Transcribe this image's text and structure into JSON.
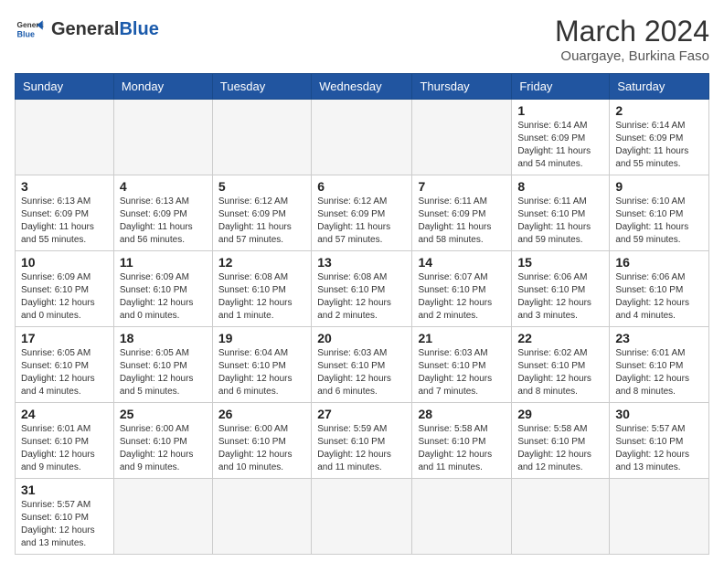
{
  "logo": {
    "text_general": "General",
    "text_blue": "Blue"
  },
  "header": {
    "month_year": "March 2024",
    "location": "Ouargaye, Burkina Faso"
  },
  "days_of_week": [
    "Sunday",
    "Monday",
    "Tuesday",
    "Wednesday",
    "Thursday",
    "Friday",
    "Saturday"
  ],
  "weeks": [
    [
      {
        "day": "",
        "info": ""
      },
      {
        "day": "",
        "info": ""
      },
      {
        "day": "",
        "info": ""
      },
      {
        "day": "",
        "info": ""
      },
      {
        "day": "",
        "info": ""
      },
      {
        "day": "1",
        "info": "Sunrise: 6:14 AM\nSunset: 6:09 PM\nDaylight: 11 hours\nand 54 minutes."
      },
      {
        "day": "2",
        "info": "Sunrise: 6:14 AM\nSunset: 6:09 PM\nDaylight: 11 hours\nand 55 minutes."
      }
    ],
    [
      {
        "day": "3",
        "info": "Sunrise: 6:13 AM\nSunset: 6:09 PM\nDaylight: 11 hours\nand 55 minutes."
      },
      {
        "day": "4",
        "info": "Sunrise: 6:13 AM\nSunset: 6:09 PM\nDaylight: 11 hours\nand 56 minutes."
      },
      {
        "day": "5",
        "info": "Sunrise: 6:12 AM\nSunset: 6:09 PM\nDaylight: 11 hours\nand 57 minutes."
      },
      {
        "day": "6",
        "info": "Sunrise: 6:12 AM\nSunset: 6:09 PM\nDaylight: 11 hours\nand 57 minutes."
      },
      {
        "day": "7",
        "info": "Sunrise: 6:11 AM\nSunset: 6:09 PM\nDaylight: 11 hours\nand 58 minutes."
      },
      {
        "day": "8",
        "info": "Sunrise: 6:11 AM\nSunset: 6:10 PM\nDaylight: 11 hours\nand 59 minutes."
      },
      {
        "day": "9",
        "info": "Sunrise: 6:10 AM\nSunset: 6:10 PM\nDaylight: 11 hours\nand 59 minutes."
      }
    ],
    [
      {
        "day": "10",
        "info": "Sunrise: 6:09 AM\nSunset: 6:10 PM\nDaylight: 12 hours\nand 0 minutes."
      },
      {
        "day": "11",
        "info": "Sunrise: 6:09 AM\nSunset: 6:10 PM\nDaylight: 12 hours\nand 0 minutes."
      },
      {
        "day": "12",
        "info": "Sunrise: 6:08 AM\nSunset: 6:10 PM\nDaylight: 12 hours\nand 1 minute."
      },
      {
        "day": "13",
        "info": "Sunrise: 6:08 AM\nSunset: 6:10 PM\nDaylight: 12 hours\nand 2 minutes."
      },
      {
        "day": "14",
        "info": "Sunrise: 6:07 AM\nSunset: 6:10 PM\nDaylight: 12 hours\nand 2 minutes."
      },
      {
        "day": "15",
        "info": "Sunrise: 6:06 AM\nSunset: 6:10 PM\nDaylight: 12 hours\nand 3 minutes."
      },
      {
        "day": "16",
        "info": "Sunrise: 6:06 AM\nSunset: 6:10 PM\nDaylight: 12 hours\nand 4 minutes."
      }
    ],
    [
      {
        "day": "17",
        "info": "Sunrise: 6:05 AM\nSunset: 6:10 PM\nDaylight: 12 hours\nand 4 minutes."
      },
      {
        "day": "18",
        "info": "Sunrise: 6:05 AM\nSunset: 6:10 PM\nDaylight: 12 hours\nand 5 minutes."
      },
      {
        "day": "19",
        "info": "Sunrise: 6:04 AM\nSunset: 6:10 PM\nDaylight: 12 hours\nand 6 minutes."
      },
      {
        "day": "20",
        "info": "Sunrise: 6:03 AM\nSunset: 6:10 PM\nDaylight: 12 hours\nand 6 minutes."
      },
      {
        "day": "21",
        "info": "Sunrise: 6:03 AM\nSunset: 6:10 PM\nDaylight: 12 hours\nand 7 minutes."
      },
      {
        "day": "22",
        "info": "Sunrise: 6:02 AM\nSunset: 6:10 PM\nDaylight: 12 hours\nand 8 minutes."
      },
      {
        "day": "23",
        "info": "Sunrise: 6:01 AM\nSunset: 6:10 PM\nDaylight: 12 hours\nand 8 minutes."
      }
    ],
    [
      {
        "day": "24",
        "info": "Sunrise: 6:01 AM\nSunset: 6:10 PM\nDaylight: 12 hours\nand 9 minutes."
      },
      {
        "day": "25",
        "info": "Sunrise: 6:00 AM\nSunset: 6:10 PM\nDaylight: 12 hours\nand 9 minutes."
      },
      {
        "day": "26",
        "info": "Sunrise: 6:00 AM\nSunset: 6:10 PM\nDaylight: 12 hours\nand 10 minutes."
      },
      {
        "day": "27",
        "info": "Sunrise: 5:59 AM\nSunset: 6:10 PM\nDaylight: 12 hours\nand 11 minutes."
      },
      {
        "day": "28",
        "info": "Sunrise: 5:58 AM\nSunset: 6:10 PM\nDaylight: 12 hours\nand 11 minutes."
      },
      {
        "day": "29",
        "info": "Sunrise: 5:58 AM\nSunset: 6:10 PM\nDaylight: 12 hours\nand 12 minutes."
      },
      {
        "day": "30",
        "info": "Sunrise: 5:57 AM\nSunset: 6:10 PM\nDaylight: 12 hours\nand 13 minutes."
      }
    ],
    [
      {
        "day": "31",
        "info": "Sunrise: 5:57 AM\nSunset: 6:10 PM\nDaylight: 12 hours\nand 13 minutes."
      },
      {
        "day": "",
        "info": ""
      },
      {
        "day": "",
        "info": ""
      },
      {
        "day": "",
        "info": ""
      },
      {
        "day": "",
        "info": ""
      },
      {
        "day": "",
        "info": ""
      },
      {
        "day": "",
        "info": ""
      }
    ]
  ]
}
